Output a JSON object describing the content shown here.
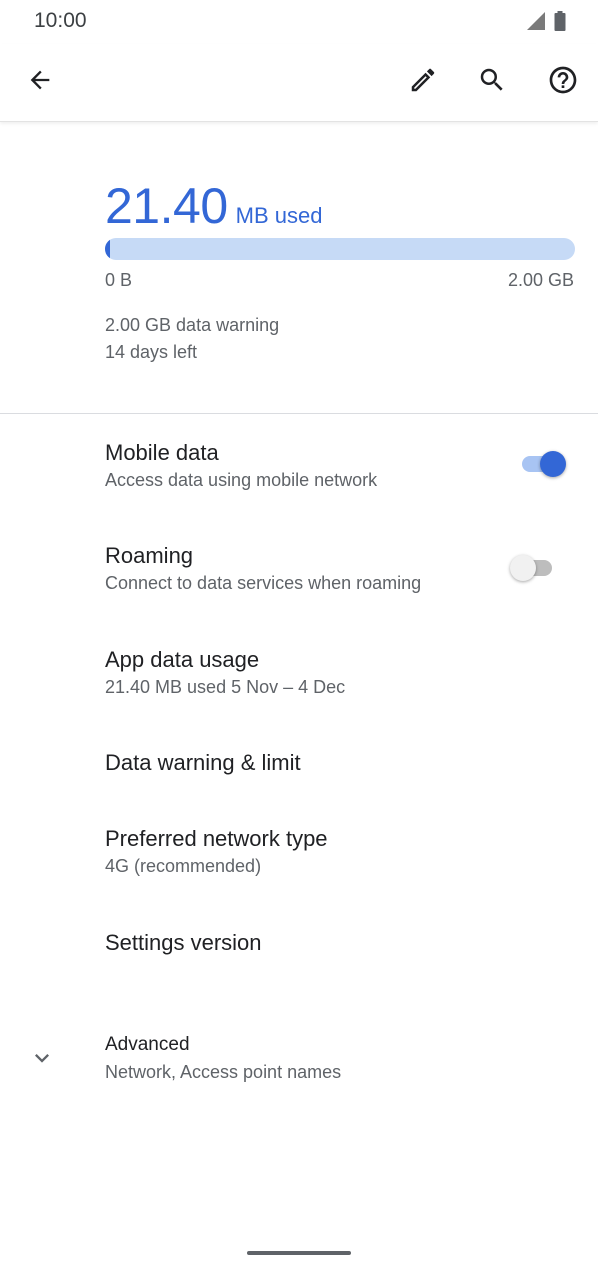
{
  "status_bar": {
    "time": "10:00",
    "icons": [
      "signal-icon",
      "battery-icon"
    ]
  },
  "app_bar": {
    "icons": [
      "back-arrow-icon",
      "edit-pencil-icon",
      "search-icon",
      "help-icon"
    ]
  },
  "usage": {
    "amount": "21.40",
    "unit_label": "MB used",
    "bar_min_label": "0 B",
    "bar_max_label": "2.00 GB",
    "used_fraction": 0.0107,
    "warning_text": "2.00 GB data warning",
    "days_left_text": "14 days left"
  },
  "preferences": {
    "mobile_data": {
      "title": "Mobile data",
      "summary": "Access data using mobile network",
      "enabled": true
    },
    "roaming": {
      "title": "Roaming",
      "summary": "Connect to data services when roaming",
      "enabled": false
    },
    "app_data_usage": {
      "title": "App data usage",
      "summary": "21.40 MB used 5 Nov – 4 Dec"
    },
    "data_warning_limit": {
      "title": "Data warning & limit"
    },
    "preferred_network": {
      "title": "Preferred network type",
      "summary": "4G (recommended)"
    },
    "settings_version": {
      "title": "Settings version"
    },
    "advanced": {
      "title": "Advanced",
      "summary": "Network, Access point names",
      "icon": "chevron-down-icon"
    }
  },
  "colors": {
    "accent": "#3367d6",
    "accent_light": "#c6daf6",
    "text_primary": "#202124",
    "text_secondary": "#5f6368"
  }
}
